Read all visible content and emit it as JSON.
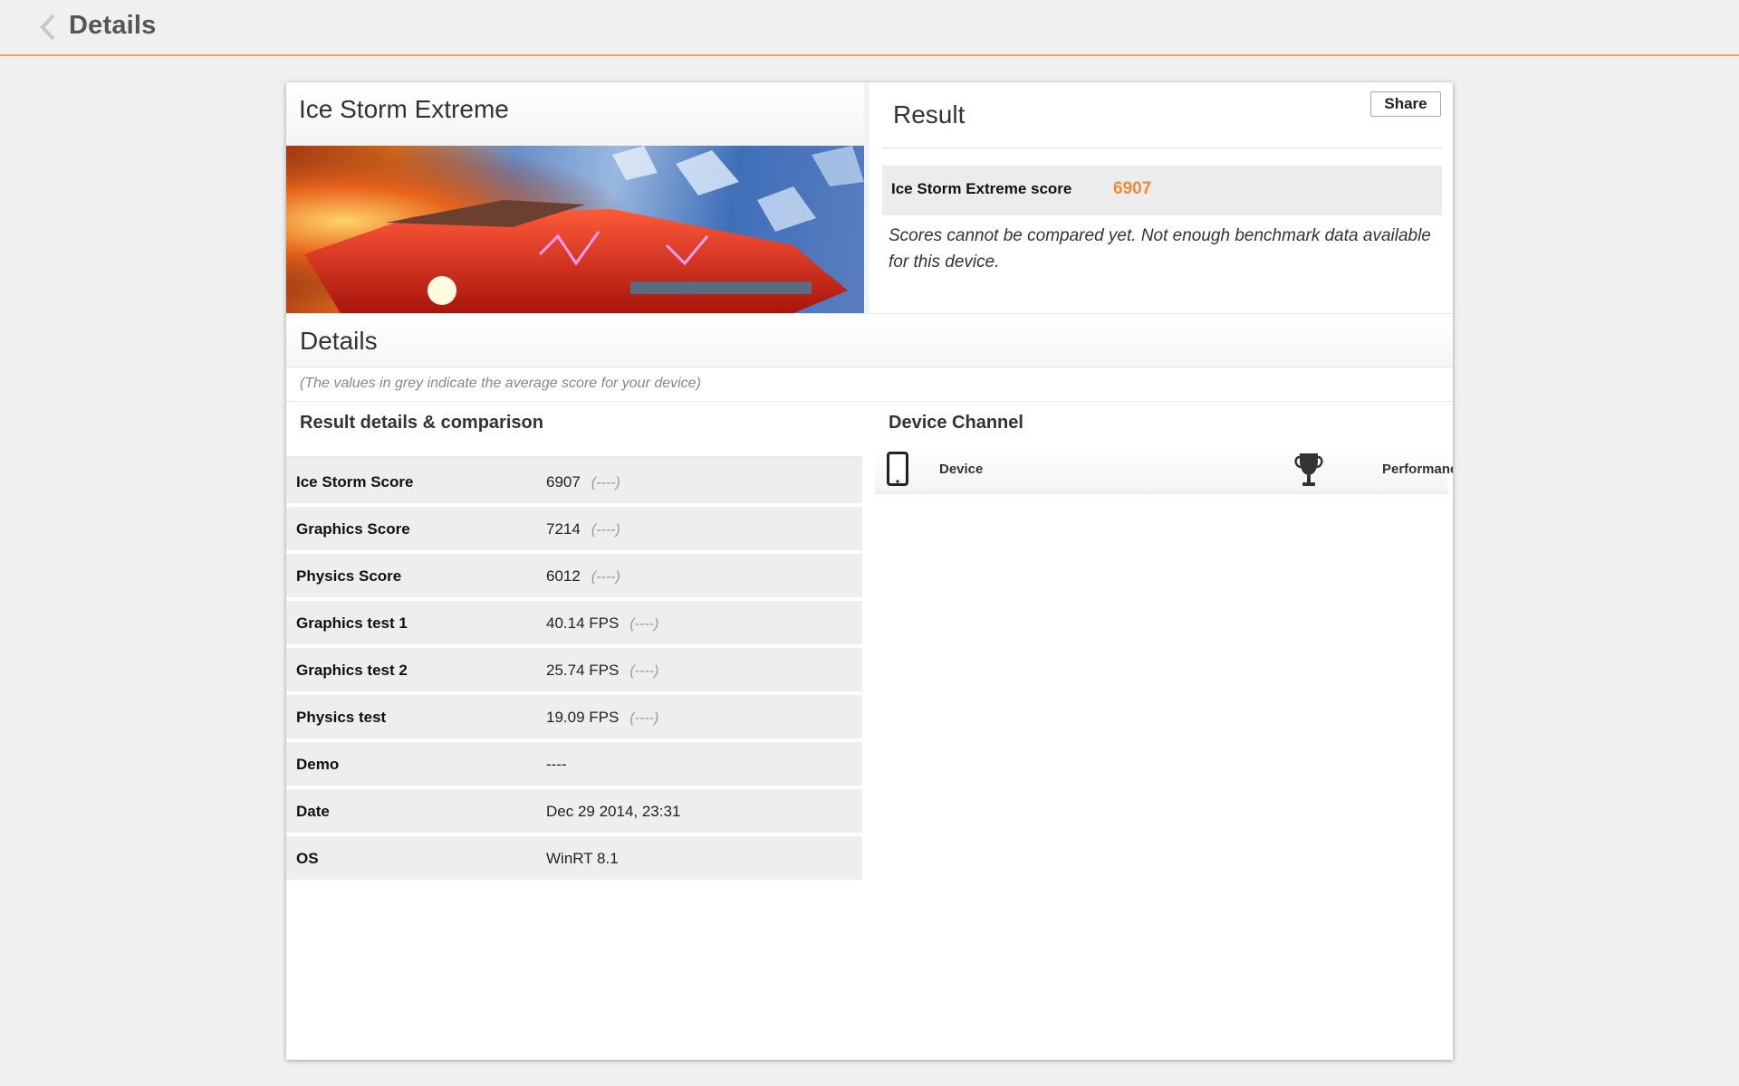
{
  "app_bar": {
    "title": "Details",
    "back_icon": "chevron-left-icon"
  },
  "test": {
    "title": "Ice Storm Extreme"
  },
  "result": {
    "title": "Result",
    "share_label": "Share",
    "score_label": "Ice Storm Extreme score",
    "score_value": "6907",
    "compare_note": "Scores cannot be compared yet. Not enough benchmark data available for this device."
  },
  "details": {
    "title": "Details",
    "grey_note": "(The values in grey indicate the average score for your device)",
    "left_title": "Result details & comparison",
    "rows": [
      {
        "label": "Ice Storm Score",
        "value": "6907",
        "avg": "(----)"
      },
      {
        "label": "Graphics Score",
        "value": "7214",
        "avg": "(----)"
      },
      {
        "label": "Physics Score",
        "value": "6012",
        "avg": "(----)"
      },
      {
        "label": "Graphics test 1",
        "value": "40.14 FPS",
        "avg": "(----)"
      },
      {
        "label": "Graphics test 2",
        "value": "25.74 FPS",
        "avg": "(----)"
      },
      {
        "label": "Physics test",
        "value": "19.09 FPS",
        "avg": "(----)"
      },
      {
        "label": "Demo",
        "value": "----",
        "avg": ""
      },
      {
        "label": "Date",
        "value": "Dec 29 2014, 23:31",
        "avg": ""
      },
      {
        "label": "OS",
        "value": "WinRT 8.1",
        "avg": ""
      }
    ]
  },
  "device_channel": {
    "title": "Device Channel",
    "device_label": "Device",
    "performance_label": "Performance",
    "device_icon": "phone-icon",
    "performance_icon": "trophy-icon"
  },
  "colors": {
    "accent": "#f08a38",
    "app_bar_border": "#f0a060"
  }
}
